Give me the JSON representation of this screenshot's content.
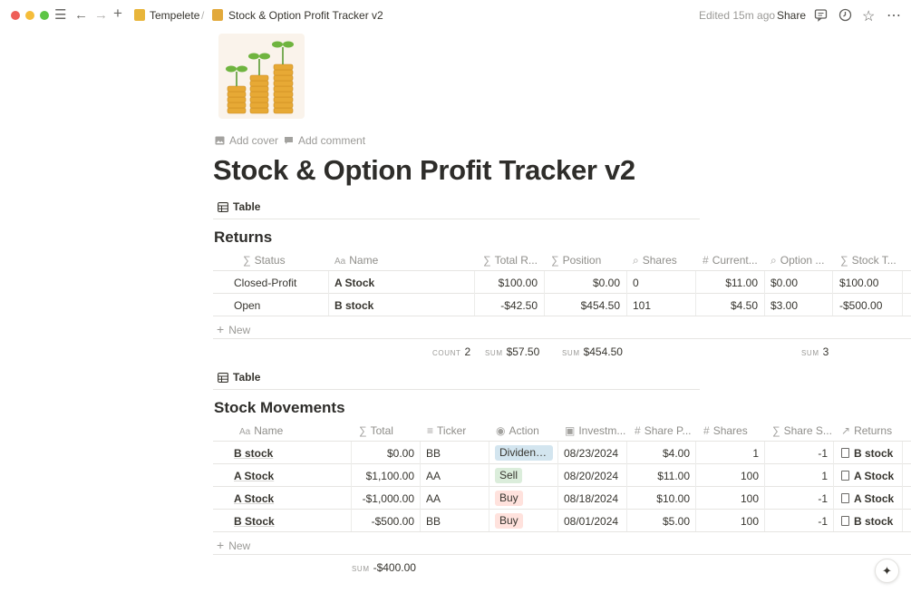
{
  "breadcrumb": {
    "workspace": "Tempelete",
    "sep": "/",
    "page": "Stock & Option Profit Tracker v2"
  },
  "topbar": {
    "edited": "Edited 15m ago",
    "share": "Share"
  },
  "page": {
    "add_cover": "Add cover",
    "add_comment": "Add comment",
    "title": "Stock & Option Profit Tracker v2"
  },
  "returns": {
    "view_label": "Table",
    "title": "Returns",
    "columns": [
      "Status",
      "Name",
      "Total R...",
      "Position",
      "Shares",
      "Current...",
      "Option ...",
      "Stock T..."
    ],
    "rows": [
      [
        "Closed-Profit",
        "A Stock",
        "$100.00",
        "$0.00",
        "0",
        "$11.00",
        "$0.00",
        "$100.00"
      ],
      [
        "Open",
        "B stock",
        "-$42.50",
        "$454.50",
        "101",
        "$4.50",
        "$3.00",
        "-$500.00"
      ]
    ],
    "new_label": "New",
    "footer": {
      "count_label": "COUNT",
      "count": "2",
      "sum_label": "SUM",
      "sum_total": "$57.50",
      "sum_position": "$454.50",
      "sum_shares": "3"
    }
  },
  "movements": {
    "view_label": "Table",
    "title": "Stock Movements",
    "columns": [
      "Name",
      "Total",
      "Ticker",
      "Action",
      "Investm...",
      "Share P...",
      "Shares",
      "Share S...",
      "Returns"
    ],
    "rows": [
      {
        "name": "B stock",
        "total": "$0.00",
        "ticker": "BB",
        "action": "Dividend ...",
        "action_color": "#d3e5ef",
        "date": "08/23/2024",
        "price": "$4.00",
        "shares": "1",
        "sign": "-1",
        "returns": "B stock"
      },
      {
        "name": "A Stock",
        "total": "$1,100.00",
        "ticker": "AA",
        "action": "Sell",
        "action_color": "#dbeddb",
        "date": "08/20/2024",
        "price": "$11.00",
        "shares": "100",
        "sign": "1",
        "returns": "A Stock"
      },
      {
        "name": "A Stock",
        "total": "-$1,000.00",
        "ticker": "AA",
        "action": "Buy",
        "action_color": "#ffe2dd",
        "date": "08/18/2024",
        "price": "$10.00",
        "shares": "100",
        "sign": "-1",
        "returns": "A Stock"
      },
      {
        "name": "B Stock",
        "total": "-$500.00",
        "ticker": "BB",
        "action": "Buy",
        "action_color": "#ffe2dd",
        "date": "08/01/2024",
        "price": "$5.00",
        "shares": "100",
        "sign": "-1",
        "returns": "B stock"
      }
    ],
    "new_label": "New",
    "footer": {
      "sum_label": "SUM",
      "sum_total": "-$400.00"
    }
  }
}
